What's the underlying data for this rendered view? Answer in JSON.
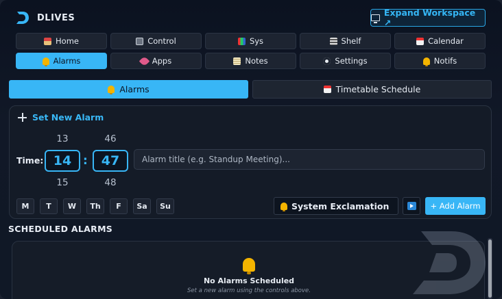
{
  "app": {
    "brand": "DLIVES",
    "expand_label": "Expand Workspace ↗"
  },
  "nav": [
    {
      "label": "Home",
      "icon": "house-icon"
    },
    {
      "label": "Control",
      "icon": "control-icon"
    },
    {
      "label": "Sys",
      "icon": "bar-chart-icon"
    },
    {
      "label": "Shelf",
      "icon": "shelf-icon"
    },
    {
      "label": "Calendar",
      "icon": "calendar-icon"
    },
    {
      "label": "Alarms",
      "icon": "bell-icon",
      "active": true
    },
    {
      "label": "Apps",
      "icon": "rocket-icon"
    },
    {
      "label": "Notes",
      "icon": "notes-icon"
    },
    {
      "label": "Settings",
      "icon": "gear-icon"
    },
    {
      "label": "Notifs",
      "icon": "bell-icon"
    }
  ],
  "subtabs": [
    {
      "label": "Alarms",
      "icon": "bell-icon",
      "active": true
    },
    {
      "label": "Timetable Schedule",
      "icon": "calendar-icon"
    }
  ],
  "alarm_form": {
    "title": "Set New Alarm",
    "time_label": "Time:",
    "hour": {
      "prev": "13",
      "value": "14",
      "next": "15"
    },
    "minute": {
      "prev": "46",
      "value": "47",
      "next": "48"
    },
    "colon": ":",
    "title_placeholder": "Alarm title (e.g. Standup Meeting)...",
    "days": [
      "M",
      "T",
      "W",
      "Th",
      "F",
      "Sa",
      "Su"
    ],
    "sound": "System Exclamation",
    "add_label": "+ Add Alarm"
  },
  "scheduled": {
    "heading": "SCHEDULED ALARMS",
    "empty_title": "No Alarms Scheduled",
    "empty_subtitle": "Set a new alarm using the controls above."
  },
  "colors": {
    "accent": "#38b6f6",
    "background": "#111827",
    "bell": "#f4b400"
  }
}
